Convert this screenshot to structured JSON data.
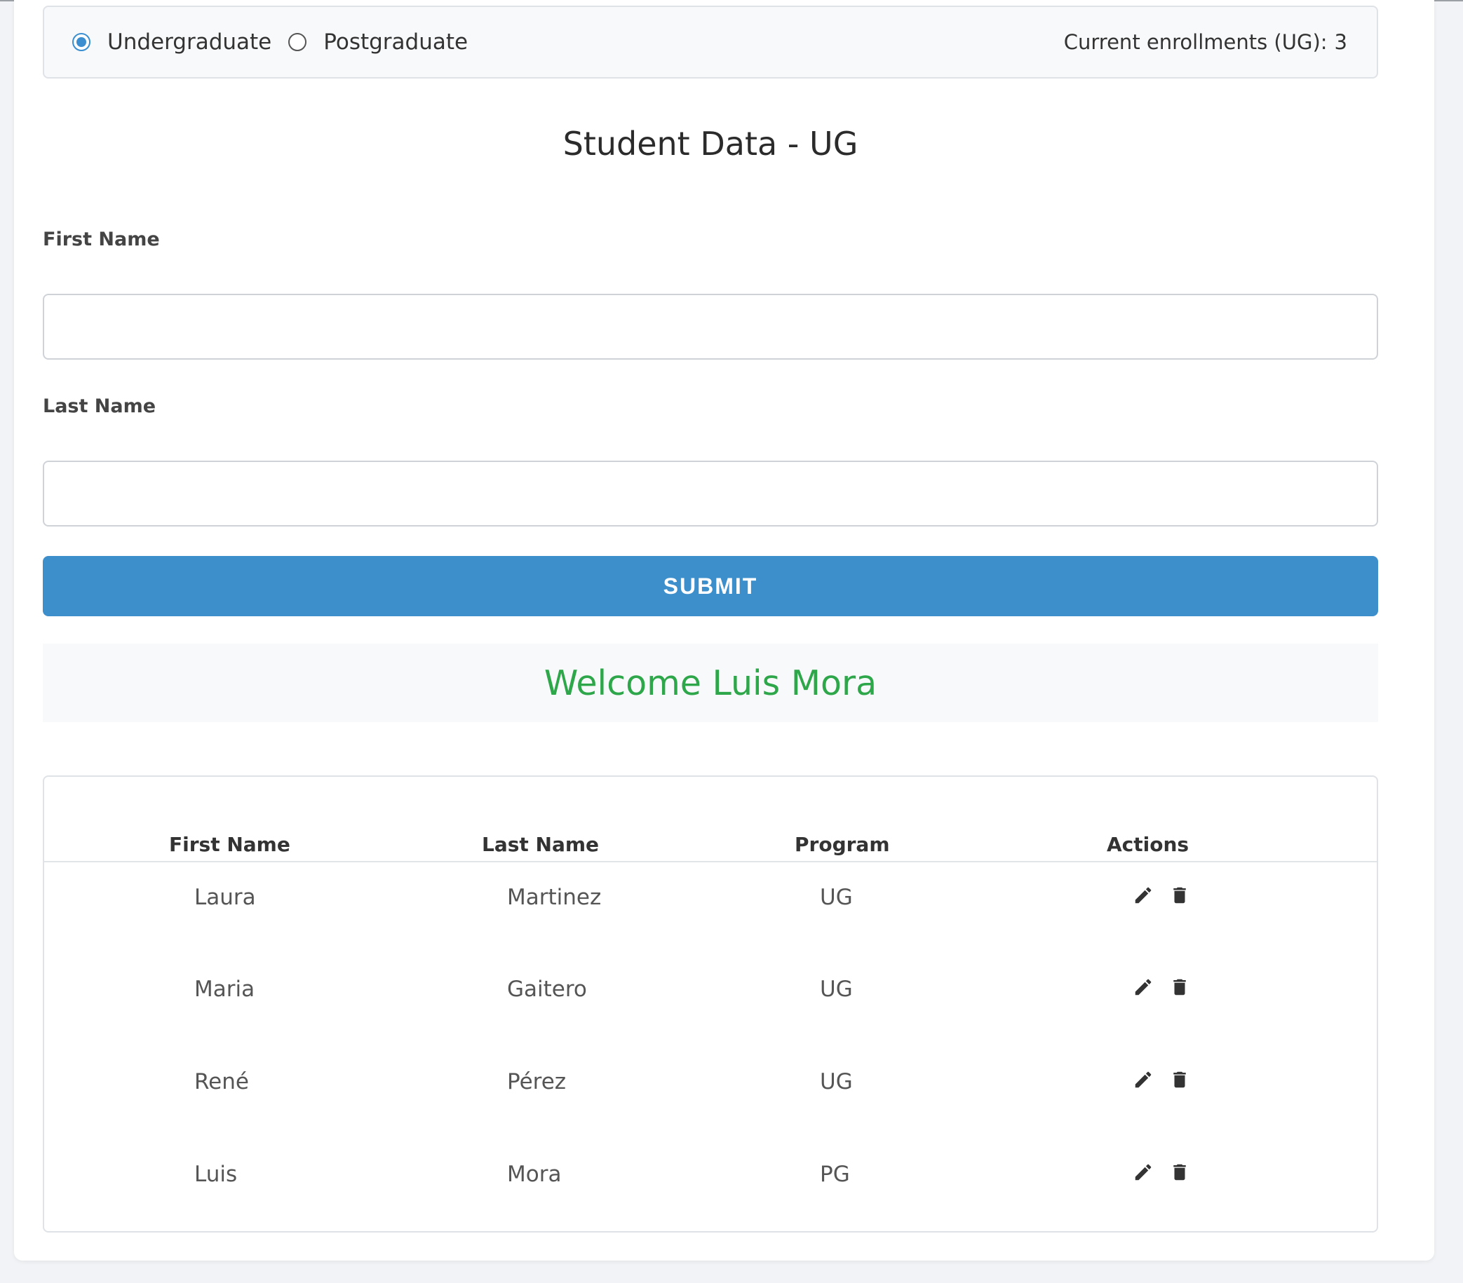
{
  "program_selector": {
    "options": [
      {
        "label": "Undergraduate",
        "checked": true
      },
      {
        "label": "Postgraduate",
        "checked": false
      }
    ],
    "enrollment_label": "Current enrollments (UG):",
    "enrollment_count": "3"
  },
  "form": {
    "title": "Student Data - UG",
    "first_name_label": "First Name",
    "first_name_value": "",
    "last_name_label": "Last Name",
    "last_name_value": "",
    "submit_label": "SUBMIT"
  },
  "welcome_message": "Welcome Luis Mora",
  "table": {
    "headers": [
      "First Name",
      "Last Name",
      "Program",
      "Actions"
    ],
    "rows": [
      {
        "first": "Laura",
        "last": "Martinez",
        "program": "UG"
      },
      {
        "first": "Maria",
        "last": "Gaitero",
        "program": "UG"
      },
      {
        "first": "René",
        "last": "Pérez",
        "program": "UG"
      },
      {
        "first": "Luis",
        "last": "Mora",
        "program": "PG"
      }
    ],
    "action_icons": [
      "edit-pencil-icon",
      "delete-trash-icon"
    ]
  },
  "colors": {
    "accent": "#3d8fcc",
    "welcome_text": "#2ea64a",
    "panel_bg": "#f8f9fa"
  }
}
